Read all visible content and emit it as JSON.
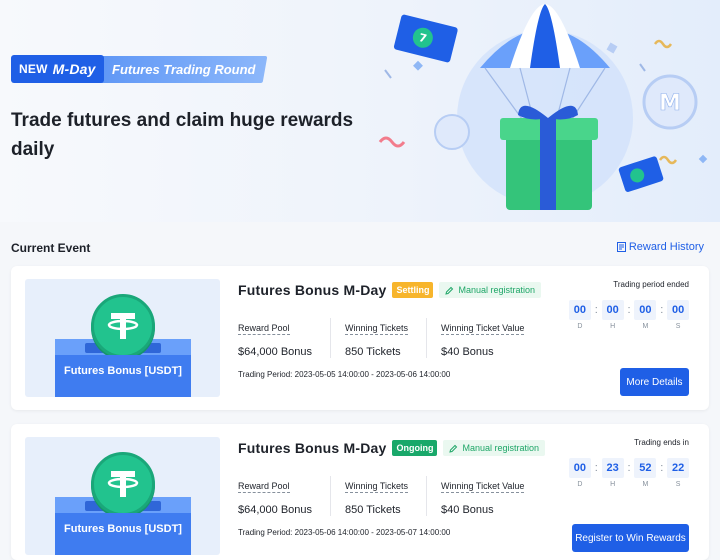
{
  "hero": {
    "badge_new": "NEW",
    "badge_mday": "M-Day",
    "badge_subtitle": "Futures Trading Round",
    "title": "Trade futures and claim huge rewards daily"
  },
  "section": {
    "title": "Current Event",
    "reward_history": "Reward History"
  },
  "events": [
    {
      "title": "Futures Bonus M-Day",
      "status": "Settling",
      "registration": "Manual registration",
      "thumb_label": "Futures Bonus [USDT]",
      "stats": [
        {
          "label": "Reward Pool",
          "value": "$64,000 Bonus"
        },
        {
          "label": "Winning Tickets",
          "value": "850 Tickets"
        },
        {
          "label": "Winning Ticket Value",
          "value": "$40 Bonus"
        }
      ],
      "period": "Trading Period: 2023-05-05 14:00:00 - 2023-05-06 14:00:00",
      "timer_label": "Trading period ended",
      "timer": {
        "d": "00",
        "h": "00",
        "m": "00",
        "s": "00"
      },
      "button": "More Details"
    },
    {
      "title": "Futures Bonus M-Day",
      "status": "Ongoing",
      "registration": "Manual registration",
      "thumb_label": "Futures Bonus [USDT]",
      "stats": [
        {
          "label": "Reward Pool",
          "value": "$64,000 Bonus"
        },
        {
          "label": "Winning Tickets",
          "value": "850 Tickets"
        },
        {
          "label": "Winning Ticket Value",
          "value": "$40 Bonus"
        }
      ],
      "period": "Trading Period: 2023-05-06 14:00:00 - 2023-05-07 14:00:00",
      "timer_label": "Trading ends in",
      "timer": {
        "d": "00",
        "h": "23",
        "m": "52",
        "s": "22"
      },
      "button": "Register to Win Rewards"
    }
  ],
  "timer_units": {
    "d": "D",
    "h": "H",
    "m": "M",
    "s": "S"
  },
  "colors": {
    "accent": "#1f5fe6",
    "settling": "#f7b52c",
    "ongoing": "#19a86a",
    "usdt": "#22c38e"
  }
}
